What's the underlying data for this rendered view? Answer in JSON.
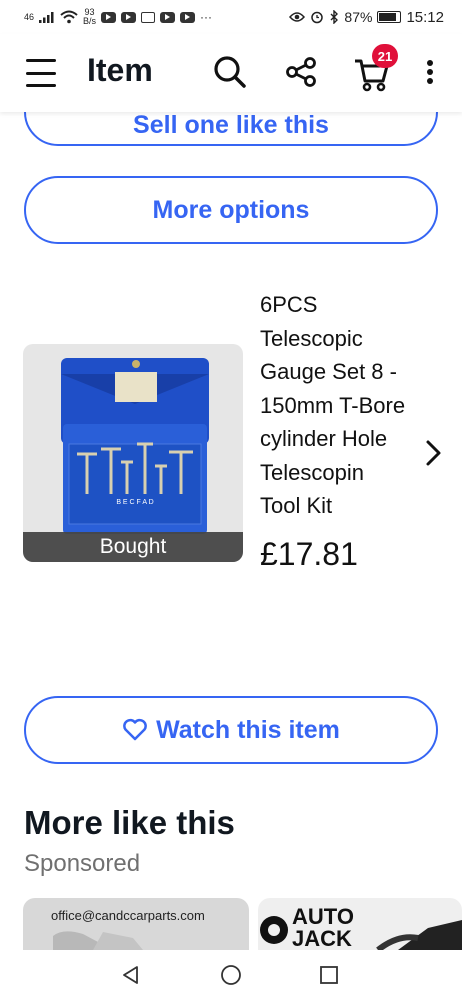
{
  "status_bar": {
    "network": "46",
    "speed_value": "93",
    "speed_unit": "B/s",
    "battery_percent": "87%",
    "battery_level": 0.87,
    "time": "15:12"
  },
  "header": {
    "title": "Item",
    "cart_count": "21",
    "accent_color": "#3665f3",
    "badge_color": "#e0103a"
  },
  "buttons": {
    "sell_label": "Sell one like this",
    "more_options_label": "More options",
    "watch_label": "Watch this item"
  },
  "product": {
    "title_lines": [
      "6PCS",
      "Telescopic",
      "Gauge Set 8 -",
      "150mm T-Bore",
      "cylinder Hole",
      "Telescopin",
      "Tool Kit"
    ],
    "price": "£17.81",
    "badge": "Bought",
    "kit_letters": "B E C F A D"
  },
  "more_like_this": {
    "title": "More like this",
    "subtitle": "Sponsored",
    "cards": [
      {
        "text": "office@candccarparts.com"
      },
      {
        "logo_line1": "AUTO",
        "logo_line2": "JACK"
      }
    ]
  },
  "icons": {
    "menu": "hamburger-icon",
    "search": "search-icon",
    "share": "share-icon",
    "cart": "cart-icon",
    "more": "more-vertical-icon",
    "next": "chevron-right-icon",
    "heart": "heart-outline-icon"
  }
}
